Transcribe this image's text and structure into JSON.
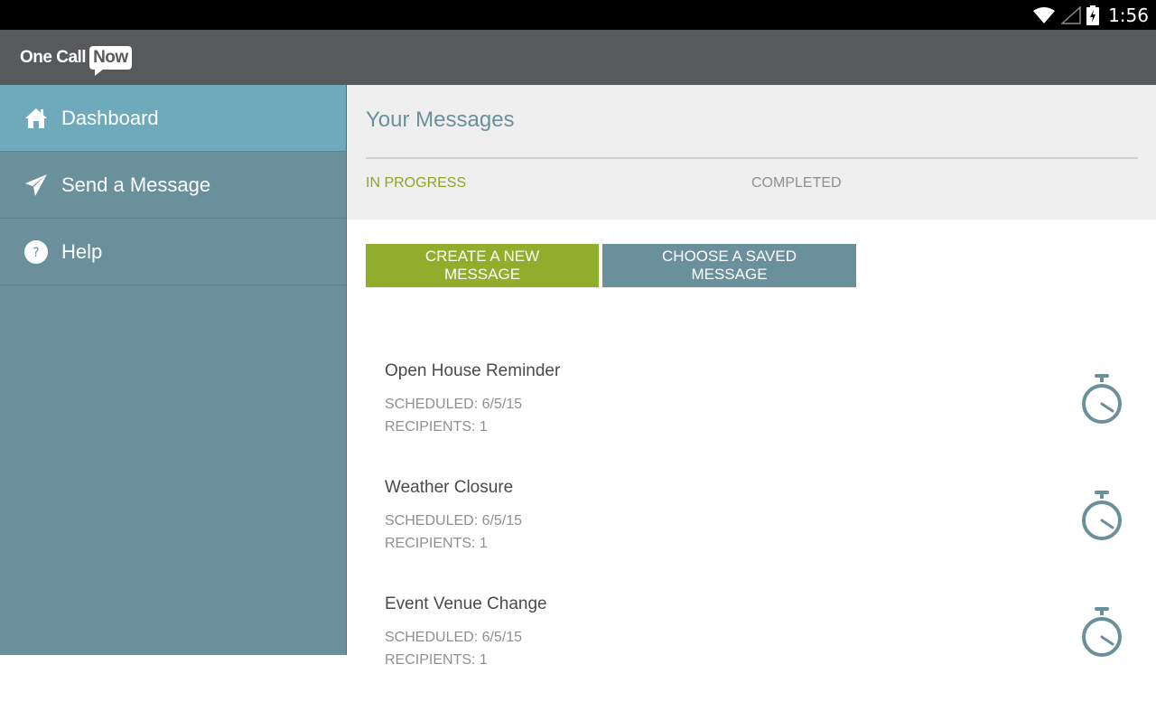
{
  "status_bar": {
    "time": "1:56",
    "icons": [
      "wifi-icon",
      "cell-signal-icon",
      "battery-charging-icon"
    ]
  },
  "app_bar": {
    "logo_text": "One Call",
    "logo_bubble_text": "Now"
  },
  "sidebar": {
    "items": [
      {
        "label": "Dashboard",
        "icon": "home-icon",
        "active": true
      },
      {
        "label": "Send a Message",
        "icon": "paper-plane-icon",
        "active": false
      },
      {
        "label": "Help",
        "icon": "help-icon",
        "active": false
      }
    ]
  },
  "main": {
    "title": "Your Messages",
    "tabs": [
      {
        "label": "IN PROGRESS",
        "active": true
      },
      {
        "label": "COMPLETED",
        "active": false
      }
    ],
    "buttons": {
      "create": "CREATE A NEW MESSAGE",
      "choose": "CHOOSE A SAVED MESSAGE"
    },
    "messages": [
      {
        "title": "Open House Reminder",
        "scheduled": "SCHEDULED: 6/5/15",
        "recipients": "RECIPIENTS: 1",
        "icon": "stopwatch-icon"
      },
      {
        "title": "Weather Closure",
        "scheduled": "SCHEDULED: 6/5/15",
        "recipients": "RECIPIENTS: 1",
        "icon": "stopwatch-icon"
      },
      {
        "title": "Event Venue Change",
        "scheduled": "SCHEDULED: 6/5/15",
        "recipients": "RECIPIENTS: 1",
        "icon": "stopwatch-icon"
      }
    ]
  },
  "colors": {
    "accent_green": "#90ad2b",
    "accent_teal": "#6a909c",
    "sidebar_active": "#6faabc",
    "app_bar": "#58595b"
  }
}
